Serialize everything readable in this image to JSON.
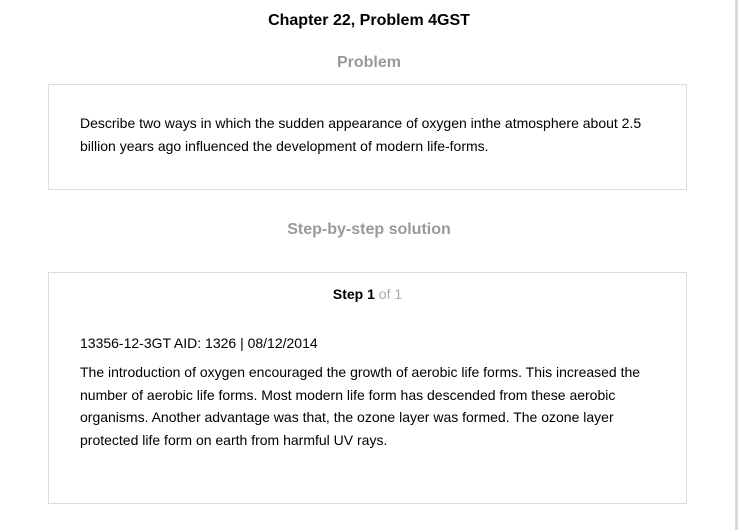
{
  "header": {
    "title": "Chapter 22, Problem 4GST"
  },
  "problem": {
    "heading": "Problem",
    "text": "Describe two ways in which the sudden appearance of oxygen inthe atmosphere about 2.5 billion years ago influenced the development of modern life-forms."
  },
  "solution": {
    "heading": "Step-by-step solution",
    "step": {
      "word": "Step",
      "number": "1",
      "of_text": "of 1"
    },
    "meta": "13356-12-3GT AID: 1326 | 08/12/2014",
    "text": "The introduction of oxygen encouraged the growth of aerobic life forms. This increased the number of aerobic life forms. Most modern life form has descended from these aerobic organisms. Another advantage was that, the ozone layer was formed. The ozone layer protected life form on earth from harmful UV rays."
  }
}
